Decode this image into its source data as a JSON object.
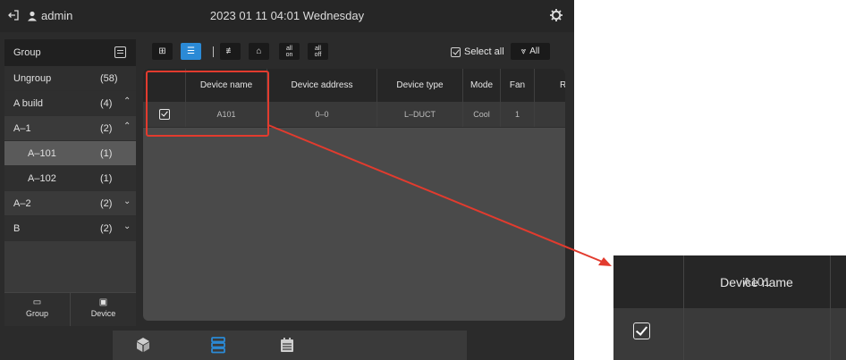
{
  "topbar": {
    "user": "admin",
    "datetime": "2023 01 11 04:01 Wednesday",
    "icons": [
      "logout-icon",
      "user-icon",
      "gear-icon"
    ]
  },
  "sidebar": {
    "title": "Group",
    "items": [
      {
        "name": "Ungroup",
        "count": "(58)",
        "chevron": ""
      },
      {
        "name": "A build",
        "count": "(4)",
        "chevron": "^"
      },
      {
        "name": "A–1",
        "count": "(2)",
        "chevron": "^"
      },
      {
        "name": "A–101",
        "count": "(1)",
        "chevron": ""
      },
      {
        "name": "A–102",
        "count": "(1)",
        "chevron": ""
      },
      {
        "name": "A–2",
        "count": "(2)",
        "chevron": "v"
      },
      {
        "name": "B",
        "count": "(2)",
        "chevron": "v"
      }
    ],
    "footer": {
      "group_label": "Group",
      "device_label": "Device"
    }
  },
  "toolbar": {
    "all_on_top": "all",
    "all_on_bottom": "on",
    "all_off_top": "all",
    "all_off_bottom": "off",
    "select_all_label": "Select all",
    "filter_label": "All"
  },
  "table": {
    "columns": [
      "Device name",
      "Device address",
      "Device type",
      "Mode",
      "Fan",
      "R"
    ],
    "rows": [
      {
        "checked": true,
        "device_name": "A101",
        "device_address": "0–0",
        "device_type": "L–DUCT",
        "mode": "Cool",
        "fan": "1"
      }
    ]
  },
  "zoom_callout": {
    "header": "Device name",
    "value": "A101"
  },
  "colors": {
    "accent": "#2b8ad6",
    "highlight": "#e23b2e",
    "background": "#2b2b2b"
  }
}
